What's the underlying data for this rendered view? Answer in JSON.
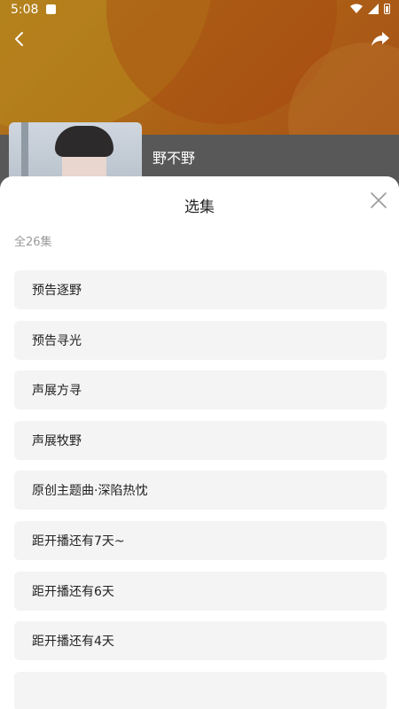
{
  "status_bar": {
    "time": "5:08"
  },
  "album": {
    "title": "野不野"
  },
  "episode_sheet": {
    "title": "选集",
    "count_label": "全26集",
    "episodes": [
      "预告逐野",
      "预告寻光",
      "声展方寻",
      "声展牧野",
      "原创主题曲·深陷热忱",
      "距开播还有7天~",
      "距开播还有6天",
      "距开播还有4天",
      ""
    ]
  },
  "colors": {
    "header_accent": "#f08a1f",
    "item_bg": "#f4f4f4"
  }
}
